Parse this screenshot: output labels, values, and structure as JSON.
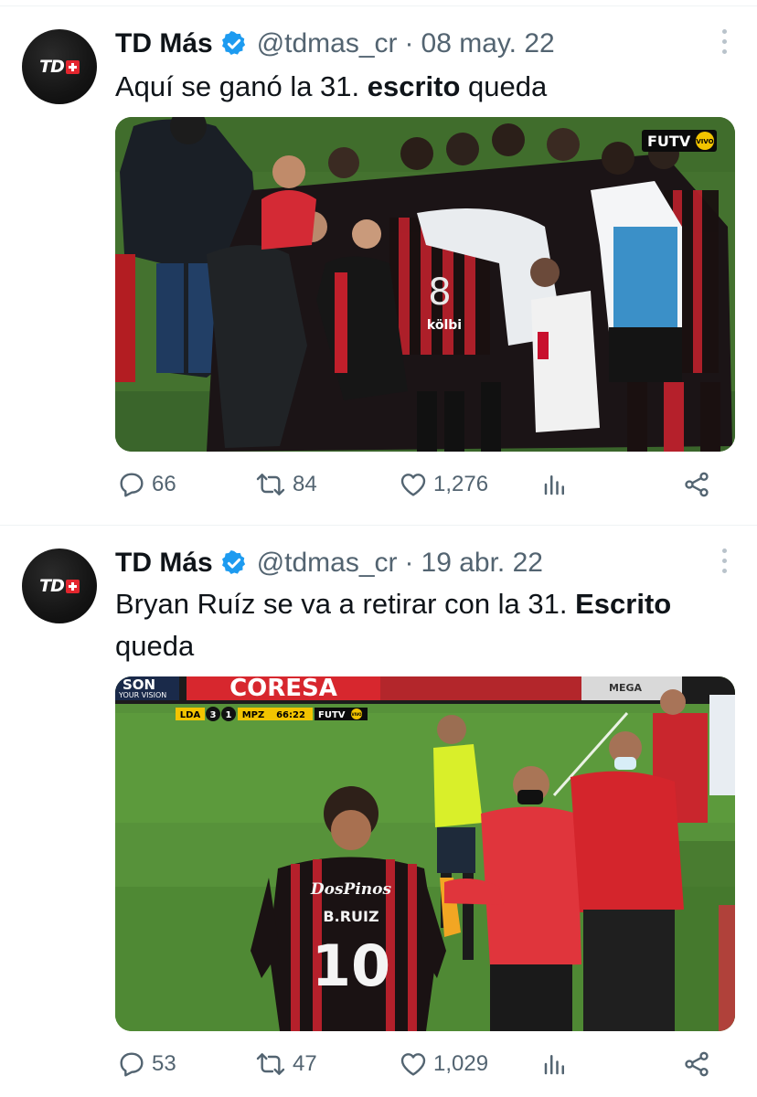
{
  "tweets": [
    {
      "author": {
        "name": "TD Más",
        "handle": "@tdmas_cr",
        "avatar_text": "TD"
      },
      "date": "08 may. 22",
      "text": {
        "before": "Aquí se ganó la 31. ",
        "bold": "escrito",
        "after": " queda"
      },
      "media": {
        "badge": "FUTV",
        "badge_live": "VIVO",
        "jersey_number": "8",
        "sponsor": "kölbi"
      },
      "stats": {
        "replies": "66",
        "retweets": "84",
        "likes": "1,276"
      }
    },
    {
      "author": {
        "name": "TD Más",
        "handle": "@tdmas_cr",
        "avatar_text": "TD"
      },
      "date": "19 abr. 22",
      "text": {
        "before": "Bryan Ruíz se va a retirar con la 31. ",
        "bold": "Escrito",
        "after": " queda"
      },
      "media": {
        "banner_left": "SON",
        "banner_left_sub": "YOUR VISION",
        "banner_main": "CORESA",
        "banner_right": "MEGA",
        "scorebug": {
          "home": "LDA",
          "home_score": "3",
          "away_score": "1",
          "away": "MPZ",
          "clock": "66:22",
          "channel": "FUTV",
          "live": "VIVO"
        },
        "jersey_name": "B.RUIZ",
        "jersey_number": "10",
        "sponsor": "DosPinos"
      },
      "stats": {
        "replies": "53",
        "retweets": "47",
        "likes": "1,029"
      }
    }
  ],
  "colors": {
    "verified": "#1d9bf0",
    "secondary_text": "#536471",
    "primary_text": "#0f1419",
    "divider": "#eff3f4"
  },
  "icons": [
    "verified-icon",
    "more-icon",
    "reply-icon",
    "retweet-icon",
    "like-icon",
    "views-icon",
    "share-icon"
  ]
}
